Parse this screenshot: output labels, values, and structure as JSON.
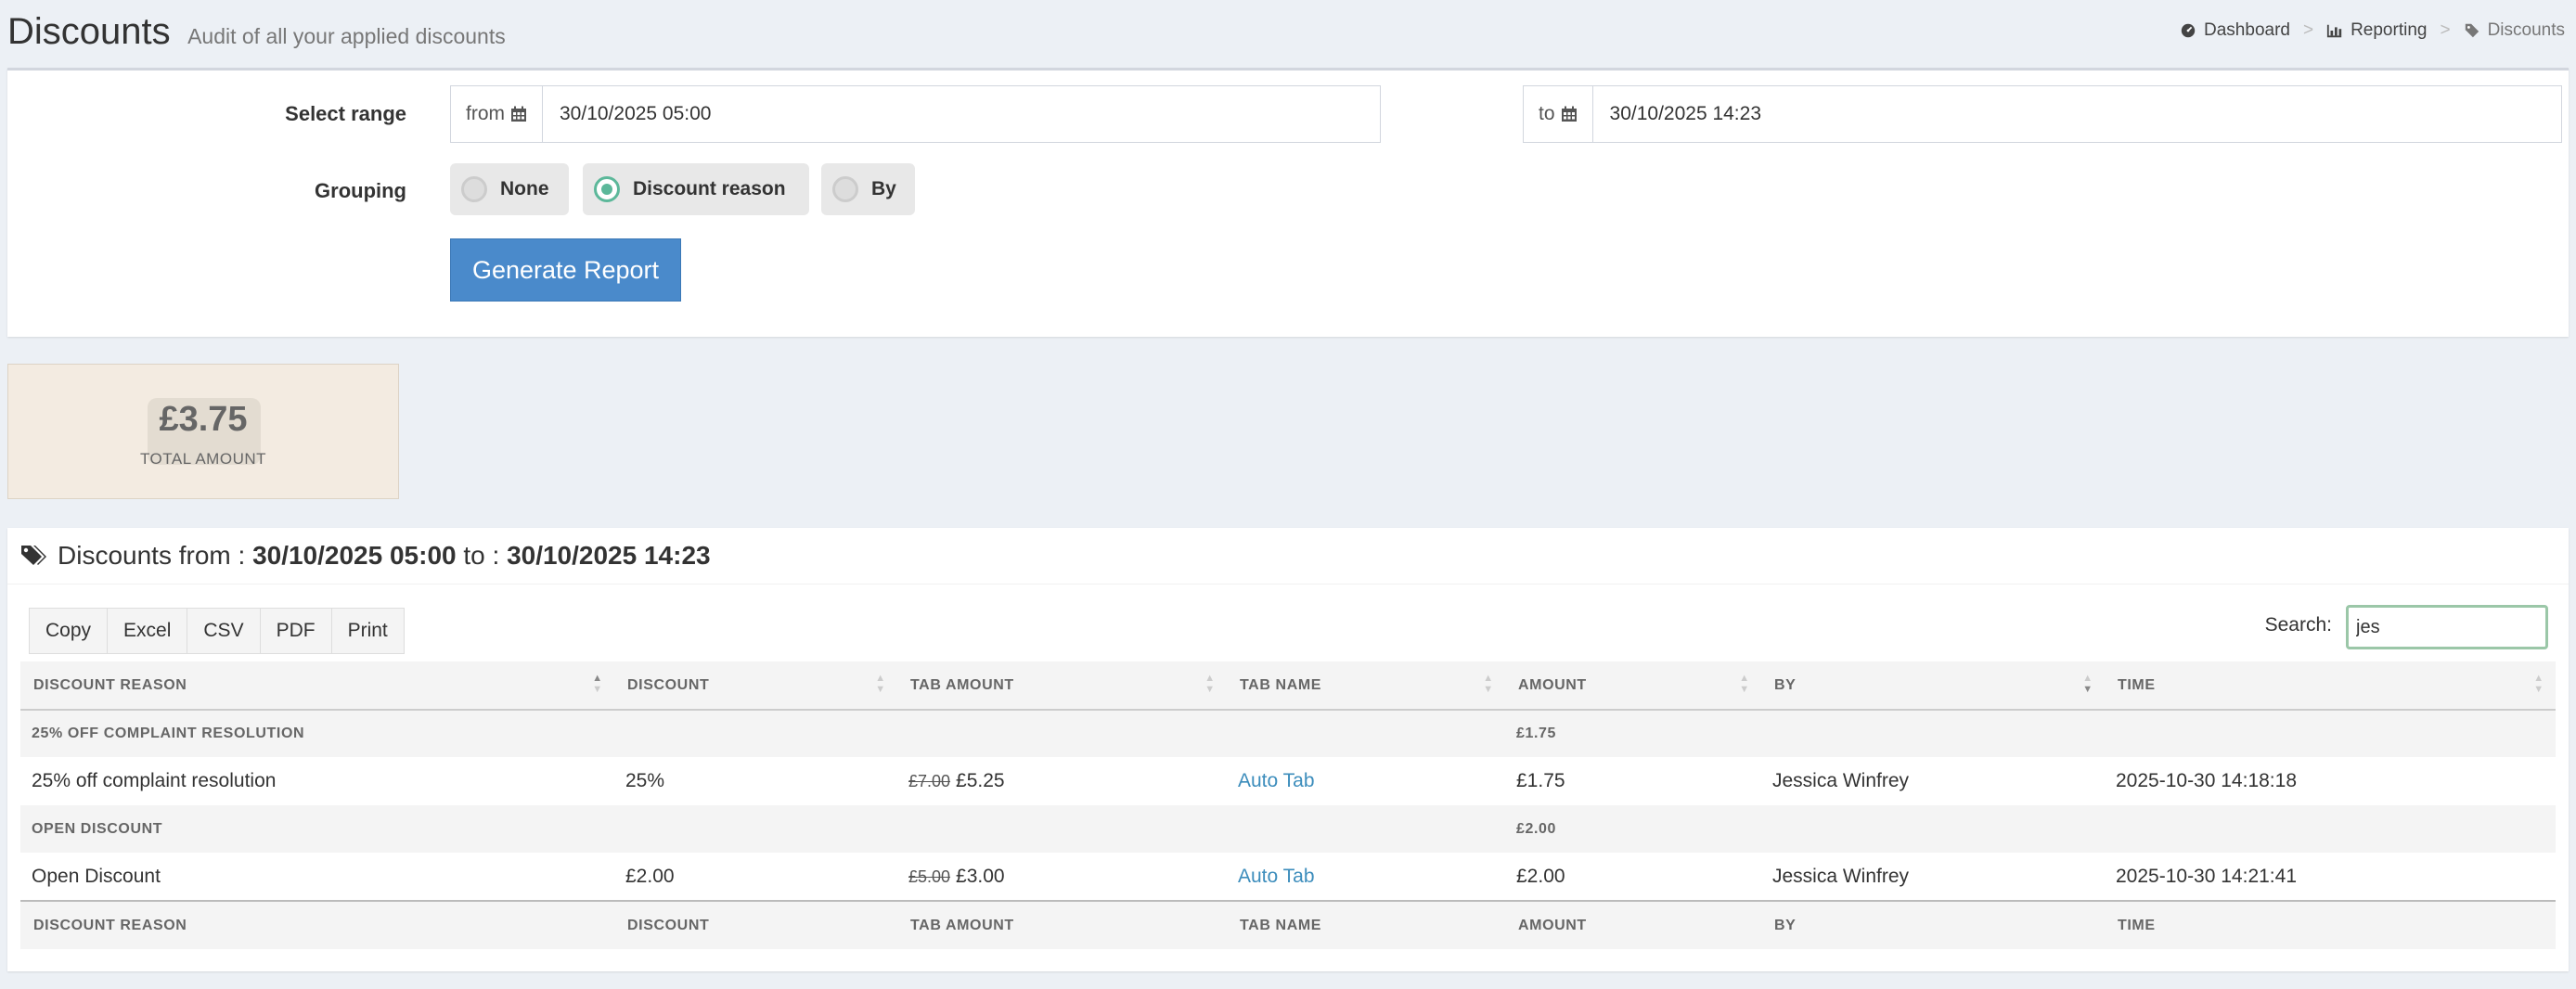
{
  "header": {
    "title": "Discounts",
    "subtitle": "Audit of all your applied discounts",
    "breadcrumb": [
      {
        "label": "Dashboard",
        "icon": "dashboard-icon"
      },
      {
        "label": "Reporting",
        "icon": "bar-chart-icon"
      },
      {
        "label": "Discounts",
        "icon": "tags-icon"
      }
    ]
  },
  "form": {
    "range_label": "Select range",
    "from_label": "from",
    "from_value": "30/10/2025 05:00",
    "to_label": "to",
    "to_value": "30/10/2025 14:23",
    "grouping_label": "Grouping",
    "grouping_options": [
      "None",
      "Discount reason",
      "By"
    ],
    "grouping_selected": "Discount reason",
    "generate_label": "Generate Report",
    "accent_color": "#5cb89a",
    "button_color": "#4a8acb"
  },
  "stat": {
    "value": "£3.75",
    "label": "TOTAL AMOUNT"
  },
  "report": {
    "title_prefix": "Discounts from : ",
    "from": "30/10/2025 05:00",
    "to_sep": " to : ",
    "to": "30/10/2025 14:23",
    "export_buttons": [
      "Copy",
      "Excel",
      "CSV",
      "PDF",
      "Print"
    ],
    "search_label": "Search:",
    "search_value": "jes",
    "columns": [
      "DISCOUNT REASON",
      "DISCOUNT",
      "TAB AMOUNT",
      "TAB NAME",
      "AMOUNT",
      "BY",
      "TIME"
    ],
    "groups": [
      {
        "name": "25% OFF COMPLAINT RESOLUTION",
        "amount": "£1.75",
        "row": {
          "reason": "25% off complaint resolution",
          "discount": "25%",
          "tab_amount_old": "£7.00",
          "tab_amount_new": "£5.25",
          "tab_name": "Auto Tab",
          "amount": "£1.75",
          "by": "Jessica Winfrey",
          "time": "2025-10-30 14:18:18"
        }
      },
      {
        "name": "OPEN DISCOUNT",
        "amount": "£2.00",
        "row": {
          "reason": "Open Discount",
          "discount": "£2.00",
          "tab_amount_old": "£5.00",
          "tab_amount_new": "£3.00",
          "tab_name": "Auto Tab",
          "amount": "£2.00",
          "by": "Jessica Winfrey",
          "time": "2025-10-30 14:21:41"
        }
      }
    ]
  }
}
